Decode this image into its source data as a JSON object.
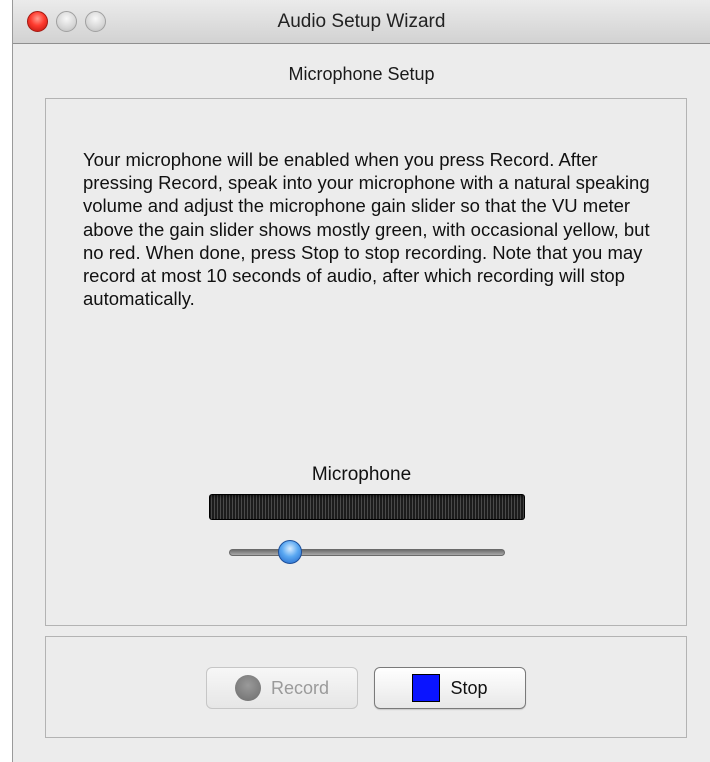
{
  "window": {
    "title": "Audio Setup Wizard"
  },
  "section": {
    "title": "Microphone Setup"
  },
  "instructions": "Your microphone will be enabled when you press Record. After pressing Record, speak into your microphone with a natural speaking volume and adjust the microphone gain slider so that the VU meter above the gain slider shows mostly green, with occasional yellow, but no red.  When done, press Stop to stop recording.  Note that you may record at most 10 seconds of audio, after which recording will stop automatically.",
  "microphone": {
    "label": "Microphone",
    "gain_level": 0.22
  },
  "buttons": {
    "record_label": "Record",
    "stop_label": "Stop"
  },
  "colors": {
    "stop_square": "#0a14ff",
    "slider_thumb": "#5aa8f2",
    "close_button": "#ff3b2f"
  },
  "icons": {
    "record": "record-circle-icon",
    "stop": "stop-square-icon"
  }
}
